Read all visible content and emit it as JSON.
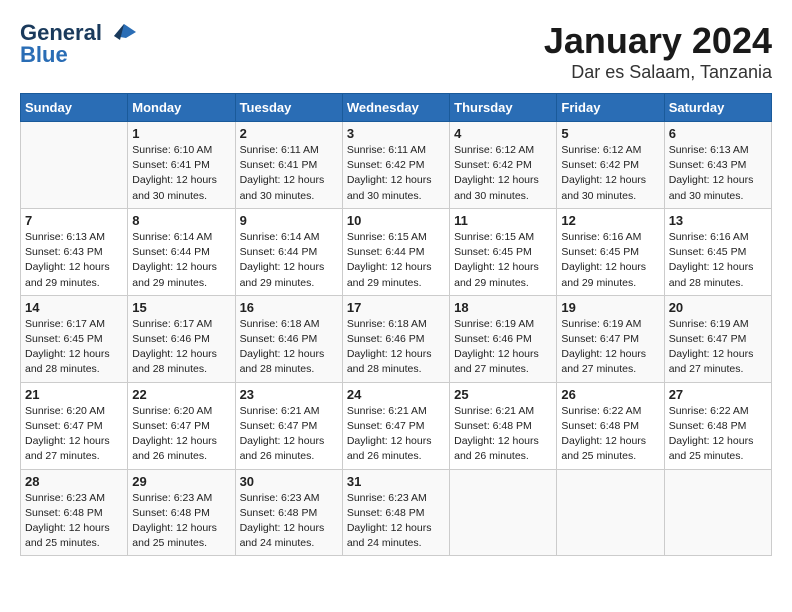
{
  "logo": {
    "line1": "General",
    "line2": "Blue"
  },
  "title": "January 2024",
  "subtitle": "Dar es Salaam, Tanzania",
  "days_of_week": [
    "Sunday",
    "Monday",
    "Tuesday",
    "Wednesday",
    "Thursday",
    "Friday",
    "Saturday"
  ],
  "weeks": [
    [
      {
        "num": "",
        "info": ""
      },
      {
        "num": "1",
        "info": "Sunrise: 6:10 AM\nSunset: 6:41 PM\nDaylight: 12 hours\nand 30 minutes."
      },
      {
        "num": "2",
        "info": "Sunrise: 6:11 AM\nSunset: 6:41 PM\nDaylight: 12 hours\nand 30 minutes."
      },
      {
        "num": "3",
        "info": "Sunrise: 6:11 AM\nSunset: 6:42 PM\nDaylight: 12 hours\nand 30 minutes."
      },
      {
        "num": "4",
        "info": "Sunrise: 6:12 AM\nSunset: 6:42 PM\nDaylight: 12 hours\nand 30 minutes."
      },
      {
        "num": "5",
        "info": "Sunrise: 6:12 AM\nSunset: 6:42 PM\nDaylight: 12 hours\nand 30 minutes."
      },
      {
        "num": "6",
        "info": "Sunrise: 6:13 AM\nSunset: 6:43 PM\nDaylight: 12 hours\nand 30 minutes."
      }
    ],
    [
      {
        "num": "7",
        "info": "Sunrise: 6:13 AM\nSunset: 6:43 PM\nDaylight: 12 hours\nand 29 minutes."
      },
      {
        "num": "8",
        "info": "Sunrise: 6:14 AM\nSunset: 6:44 PM\nDaylight: 12 hours\nand 29 minutes."
      },
      {
        "num": "9",
        "info": "Sunrise: 6:14 AM\nSunset: 6:44 PM\nDaylight: 12 hours\nand 29 minutes."
      },
      {
        "num": "10",
        "info": "Sunrise: 6:15 AM\nSunset: 6:44 PM\nDaylight: 12 hours\nand 29 minutes."
      },
      {
        "num": "11",
        "info": "Sunrise: 6:15 AM\nSunset: 6:45 PM\nDaylight: 12 hours\nand 29 minutes."
      },
      {
        "num": "12",
        "info": "Sunrise: 6:16 AM\nSunset: 6:45 PM\nDaylight: 12 hours\nand 29 minutes."
      },
      {
        "num": "13",
        "info": "Sunrise: 6:16 AM\nSunset: 6:45 PM\nDaylight: 12 hours\nand 28 minutes."
      }
    ],
    [
      {
        "num": "14",
        "info": "Sunrise: 6:17 AM\nSunset: 6:45 PM\nDaylight: 12 hours\nand 28 minutes."
      },
      {
        "num": "15",
        "info": "Sunrise: 6:17 AM\nSunset: 6:46 PM\nDaylight: 12 hours\nand 28 minutes."
      },
      {
        "num": "16",
        "info": "Sunrise: 6:18 AM\nSunset: 6:46 PM\nDaylight: 12 hours\nand 28 minutes."
      },
      {
        "num": "17",
        "info": "Sunrise: 6:18 AM\nSunset: 6:46 PM\nDaylight: 12 hours\nand 28 minutes."
      },
      {
        "num": "18",
        "info": "Sunrise: 6:19 AM\nSunset: 6:46 PM\nDaylight: 12 hours\nand 27 minutes."
      },
      {
        "num": "19",
        "info": "Sunrise: 6:19 AM\nSunset: 6:47 PM\nDaylight: 12 hours\nand 27 minutes."
      },
      {
        "num": "20",
        "info": "Sunrise: 6:19 AM\nSunset: 6:47 PM\nDaylight: 12 hours\nand 27 minutes."
      }
    ],
    [
      {
        "num": "21",
        "info": "Sunrise: 6:20 AM\nSunset: 6:47 PM\nDaylight: 12 hours\nand 27 minutes."
      },
      {
        "num": "22",
        "info": "Sunrise: 6:20 AM\nSunset: 6:47 PM\nDaylight: 12 hours\nand 26 minutes."
      },
      {
        "num": "23",
        "info": "Sunrise: 6:21 AM\nSunset: 6:47 PM\nDaylight: 12 hours\nand 26 minutes."
      },
      {
        "num": "24",
        "info": "Sunrise: 6:21 AM\nSunset: 6:47 PM\nDaylight: 12 hours\nand 26 minutes."
      },
      {
        "num": "25",
        "info": "Sunrise: 6:21 AM\nSunset: 6:48 PM\nDaylight: 12 hours\nand 26 minutes."
      },
      {
        "num": "26",
        "info": "Sunrise: 6:22 AM\nSunset: 6:48 PM\nDaylight: 12 hours\nand 25 minutes."
      },
      {
        "num": "27",
        "info": "Sunrise: 6:22 AM\nSunset: 6:48 PM\nDaylight: 12 hours\nand 25 minutes."
      }
    ],
    [
      {
        "num": "28",
        "info": "Sunrise: 6:23 AM\nSunset: 6:48 PM\nDaylight: 12 hours\nand 25 minutes."
      },
      {
        "num": "29",
        "info": "Sunrise: 6:23 AM\nSunset: 6:48 PM\nDaylight: 12 hours\nand 25 minutes."
      },
      {
        "num": "30",
        "info": "Sunrise: 6:23 AM\nSunset: 6:48 PM\nDaylight: 12 hours\nand 24 minutes."
      },
      {
        "num": "31",
        "info": "Sunrise: 6:23 AM\nSunset: 6:48 PM\nDaylight: 12 hours\nand 24 minutes."
      },
      {
        "num": "",
        "info": ""
      },
      {
        "num": "",
        "info": ""
      },
      {
        "num": "",
        "info": ""
      }
    ]
  ]
}
